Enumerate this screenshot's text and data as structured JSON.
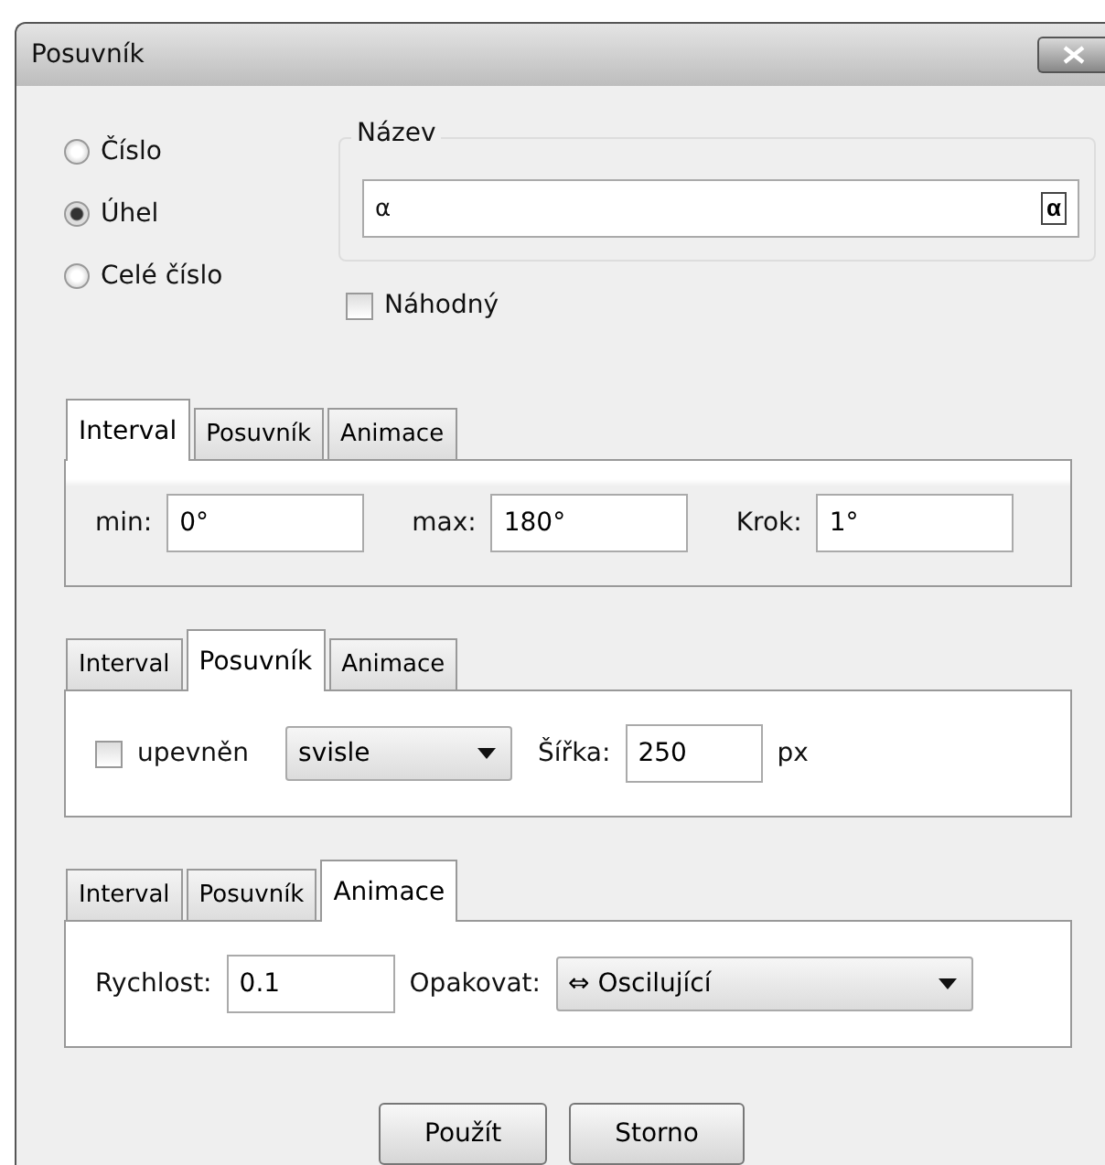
{
  "window": {
    "title": "Posuvník"
  },
  "types": [
    {
      "label": "Číslo",
      "selected": false
    },
    {
      "label": "Úhel",
      "selected": true
    },
    {
      "label": "Celé číslo",
      "selected": false
    }
  ],
  "name_group": {
    "legend": "Název",
    "value": "α",
    "symbol_button": "α"
  },
  "random": {
    "label": "Náhodný",
    "checked": false
  },
  "panels": [
    {
      "kind": "interval",
      "tabs": [
        {
          "label": "Interval",
          "selected": true
        },
        {
          "label": "Posuvník",
          "selected": false
        },
        {
          "label": "Animace",
          "selected": false
        }
      ],
      "fields": [
        {
          "label": "min:",
          "value": "0°"
        },
        {
          "label": "max:",
          "value": "180°"
        },
        {
          "label": "Krok:",
          "value": "1°"
        }
      ]
    },
    {
      "kind": "slider",
      "tabs": [
        {
          "label": "Interval",
          "selected": false
        },
        {
          "label": "Posuvník",
          "selected": true
        },
        {
          "label": "Animace",
          "selected": false
        }
      ],
      "fixed": {
        "label": "upevněn",
        "checked": false
      },
      "orientation": "svisle",
      "width_label": "Šířka:",
      "width_value": "250",
      "unit": "px"
    },
    {
      "kind": "animation",
      "tabs": [
        {
          "label": "Interval",
          "selected": false
        },
        {
          "label": "Posuvník",
          "selected": false
        },
        {
          "label": "Animace",
          "selected": true
        }
      ],
      "speed_label": "Rychlost:",
      "speed_value": "0.1",
      "repeat_label": "Opakovat:",
      "repeat_value": "⇔ Oscilující"
    }
  ],
  "buttons": [
    "Použít",
    "Storno"
  ]
}
